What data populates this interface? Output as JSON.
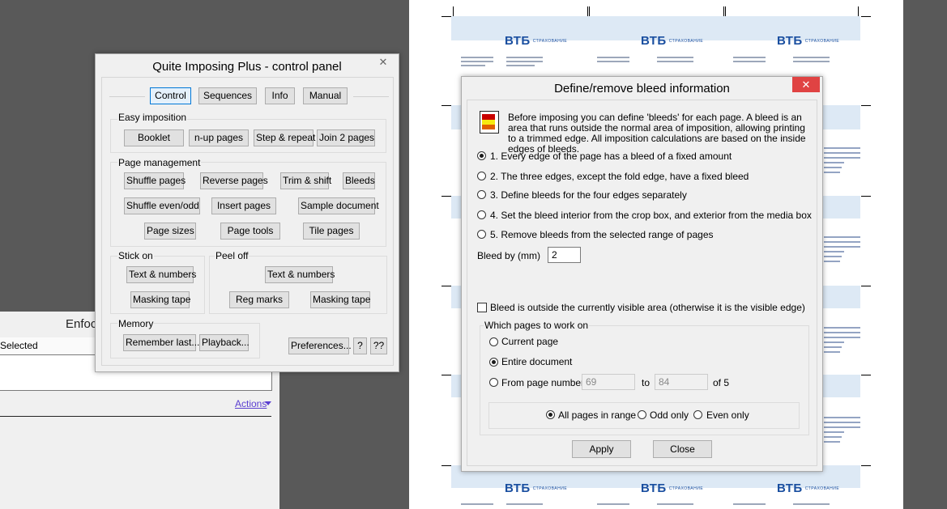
{
  "background_panel": {
    "title": "Enfoc",
    "header_label": "Selected",
    "actions_label": "Actions"
  },
  "document": {
    "logo_text": "ВТБ",
    "logo_sub": "СТРАХОВАНИЕ"
  },
  "control_panel": {
    "title": "Quite Imposing Plus - control panel",
    "close_label": "✕",
    "tabs": [
      {
        "label": "Control"
      },
      {
        "label": "Sequences"
      },
      {
        "label": "Info"
      },
      {
        "label": "Manual"
      }
    ],
    "easy_imposition": {
      "label": "Easy imposition",
      "buttons": [
        "Booklet",
        "n-up pages",
        "Step & repeat",
        "Join 2 pages"
      ]
    },
    "page_management": {
      "label": "Page management",
      "buttons": [
        "Shuffle pages",
        "Reverse pages",
        "Trim & shift",
        "Bleeds",
        "Shuffle even/odd",
        "Insert pages",
        "Sample document",
        "Page sizes",
        "Page tools",
        "Tile pages"
      ]
    },
    "stick_on": {
      "label": "Stick on",
      "buttons": [
        "Text & numbers",
        "Masking tape"
      ]
    },
    "peel_off": {
      "label": "Peel off",
      "buttons": [
        "Text & numbers",
        "Reg marks",
        "Masking tape"
      ]
    },
    "memory": {
      "label": "Memory",
      "buttons": [
        "Remember last...",
        "Playback..."
      ]
    },
    "preferences_label": "Preferences...",
    "help_label": "?",
    "help2_label": "??"
  },
  "bleed_dialog": {
    "title": "Define/remove bleed information",
    "close_label": "✕",
    "description": "Before imposing you can define 'bleeds' for each page. A bleed is an area that runs outside the normal area of imposition, allowing printing to a trimmed edge. All imposition calculations are based on the inside edges of bleeds.",
    "options": [
      {
        "label": "1. Every edge of the page has a bleed of a fixed amount",
        "selected": true
      },
      {
        "label": "2. The three edges, except the fold edge, have a fixed bleed",
        "selected": false
      },
      {
        "label": "3. Define bleeds for the four edges separately",
        "selected": false
      },
      {
        "label": "4. Set the bleed interior from the crop box, and exterior from the media box",
        "selected": false
      },
      {
        "label": "5. Remove bleeds from the selected range of pages",
        "selected": false
      }
    ],
    "bleed_by_label": "Bleed by (mm)",
    "bleed_by_value": "2",
    "outside_check_label": "Bleed is outside the currently visible area (otherwise it is the visible edge)",
    "outside_checked": false,
    "which_pages": {
      "label": "Which pages to work on",
      "current_page": "Current page",
      "entire_document": "Entire document",
      "from_page": "From page number",
      "from_value": "69",
      "to_label": "to",
      "to_value": "84",
      "of_label": "of 5",
      "selected": "entire_document"
    },
    "range": {
      "all_pages": "All pages in range",
      "odd_only": "Odd only",
      "even_only": "Even only",
      "selected": "all_pages"
    },
    "apply_label": "Apply",
    "close_button_label": "Close"
  },
  "colors": {
    "dialog_close_red": "#e04343",
    "logo_blue": "#1a4fa0",
    "band_blue": "#dde9f5",
    "selected_tab": "#e5f1fb"
  }
}
